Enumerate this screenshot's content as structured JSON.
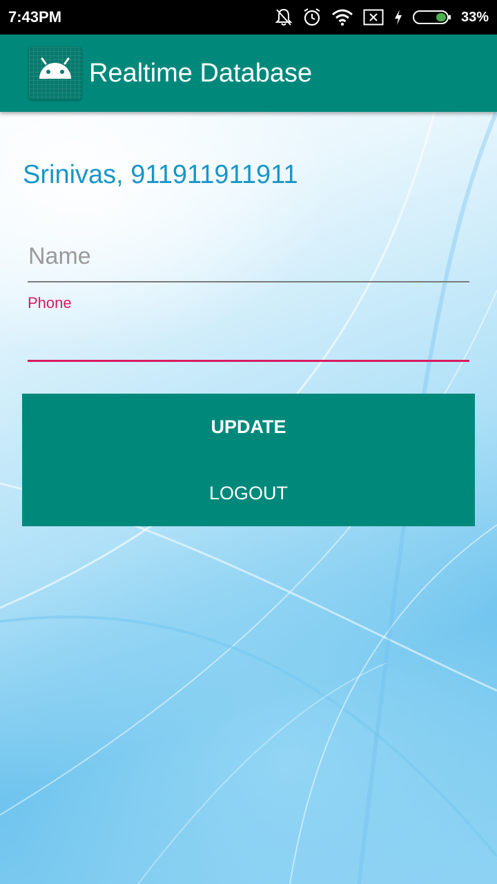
{
  "status_bar": {
    "time": "7:43PM",
    "battery_percent": "33%",
    "icons": [
      "bell-off-icon",
      "alarm-icon",
      "wifi-icon",
      "no-sim-icon",
      "charging-icon",
      "battery-icon"
    ]
  },
  "app_bar": {
    "title": "Realtime Database",
    "icon": "android-icon"
  },
  "user": {
    "display": "Srinivas, 911911911911"
  },
  "form": {
    "name_placeholder": "Name",
    "name_value": "",
    "phone_label": "Phone",
    "phone_value": ""
  },
  "buttons": {
    "update_label": "UPDATE",
    "logout_label": "LOGOUT"
  },
  "colors": {
    "primary": "#00897b",
    "accent": "#d81b60",
    "user_text": "#1796c8"
  }
}
